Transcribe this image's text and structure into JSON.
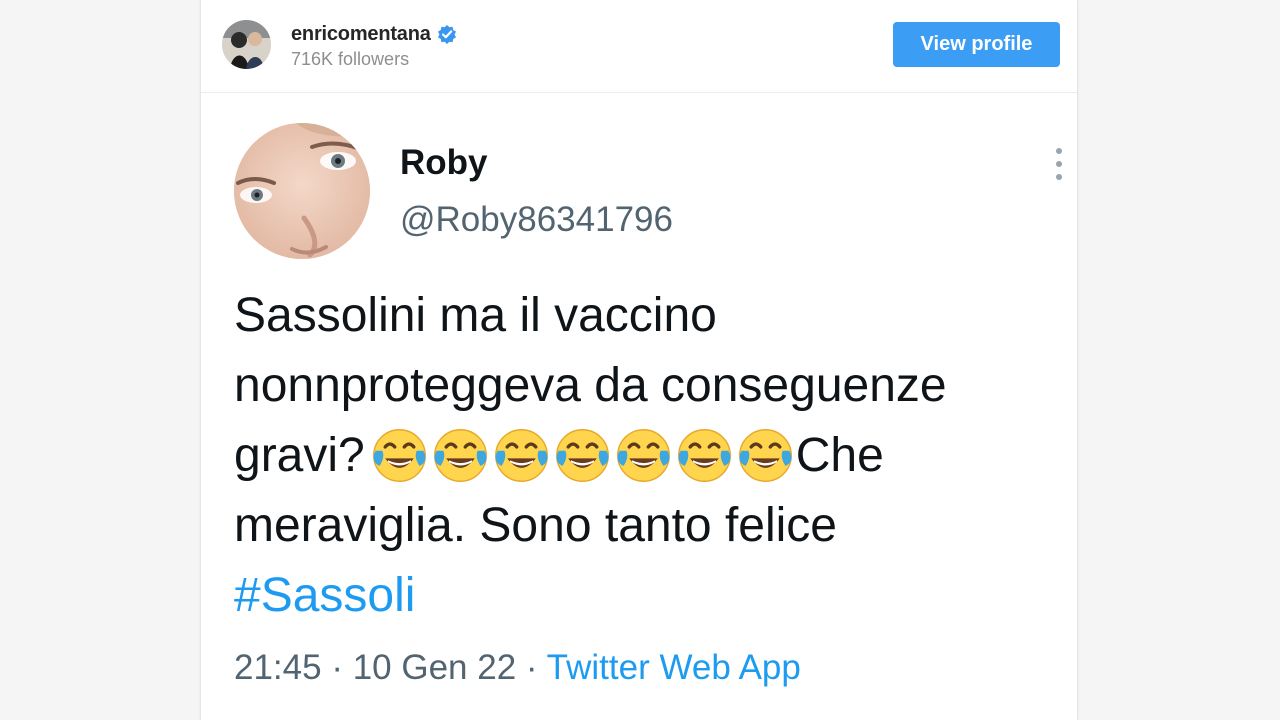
{
  "instagram_header": {
    "username": "enricomentana",
    "followers": "716K followers",
    "view_profile_label": "View profile",
    "verified_icon": "verified-badge-icon",
    "colors": {
      "button_bg": "#3b9df4",
      "verified": "#3897f0"
    }
  },
  "tweet": {
    "display_name": "Roby",
    "handle": "@Roby86341796",
    "text_line_1": "Sassolini ma il vaccino",
    "text_line_2": "nonnproteggeva da conseguenze",
    "text_line_3_start": "gravi?",
    "text_line_3_end": "Che",
    "text_line_4": "meraviglia.  Sono tanto felice",
    "hashtag": "#Sassoli",
    "emoji_count": 7,
    "emoji_icon": "face-with-tears-of-joy-icon",
    "time": "21:45",
    "separator_1": " · ",
    "date": "10 Gen 22",
    "separator_2": " · ",
    "source": "Twitter Web App",
    "more_icon": "more-vertical-icon",
    "colors": {
      "text": "#0f1419",
      "secondary": "#536471",
      "link": "#1d9bf0"
    }
  }
}
